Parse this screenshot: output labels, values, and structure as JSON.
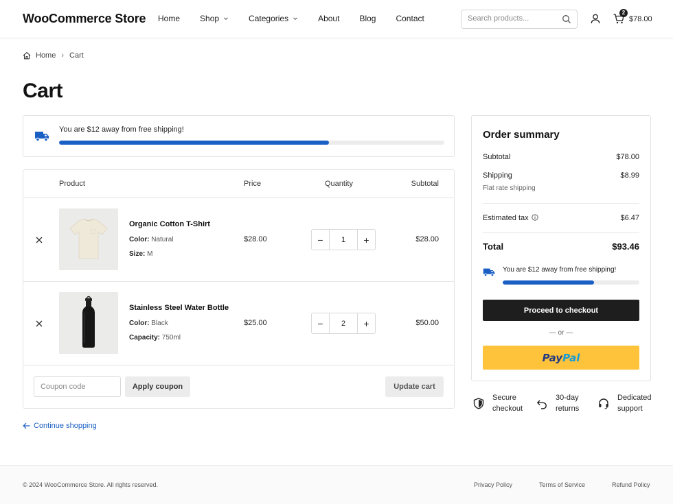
{
  "header": {
    "logo": "WooCommerce Store",
    "nav": [
      "Home",
      "Shop",
      "Categories",
      "About",
      "Blog",
      "Contact"
    ],
    "search_placeholder": "Search products...",
    "cart_count": "2",
    "cart_total": "$78.00"
  },
  "breadcrumb": {
    "home": "Home",
    "current": "Cart"
  },
  "page_title": "Cart",
  "shipping_notice": {
    "message": "You are $12 away from free shipping!",
    "progress": 0.7
  },
  "table": {
    "headers": {
      "product": "Product",
      "price": "Price",
      "quantity": "Quantity",
      "subtotal": "Subtotal"
    },
    "items": [
      {
        "name": "Organic Cotton T-Shirt",
        "attr1_label": "Color:",
        "attr1_value": "Natural",
        "attr2_label": "Size:",
        "attr2_value": "M",
        "price": "$28.00",
        "quantity": "1",
        "subtotal": "$28.00"
      },
      {
        "name": "Stainless Steel Water Bottle",
        "attr1_label": "Color:",
        "attr1_value": "Black",
        "attr2_label": "Capacity:",
        "attr2_value": "750ml",
        "price": "$25.00",
        "quantity": "2",
        "subtotal": "$50.00"
      }
    ],
    "coupon_placeholder": "Coupon code",
    "apply_label": "Apply coupon",
    "update_label": "Update cart"
  },
  "continue_label": "Continue shopping",
  "summary": {
    "title": "Order summary",
    "subtotal_label": "Subtotal",
    "subtotal_value": "$78.00",
    "shipping_label": "Shipping",
    "shipping_value": "$8.99",
    "shipping_method": "Flat rate shipping",
    "tax_label": "Estimated tax",
    "tax_value": "$6.47",
    "total_label": "Total",
    "total_value": "$93.46",
    "shipping_message": "You are $12 away from free shipping!",
    "shipping_progress": 0.67,
    "checkout_label": "Proceed to checkout",
    "or_label": "— or —",
    "paypal_pay": "Pay",
    "paypal_pal": "Pal"
  },
  "trust": [
    {
      "line1": "Secure",
      "line2": "checkout",
      "icon": "shield-icon"
    },
    {
      "line1": "30-day",
      "line2": "returns",
      "icon": "return-arrow-icon"
    },
    {
      "line1": "Dedicated",
      "line2": "support",
      "icon": "headset-icon"
    }
  ],
  "footer": {
    "copyright": "© 2024 WooCommerce Store. All rights reserved.",
    "links": [
      "Privacy Policy",
      "Terms of Service",
      "Refund Policy"
    ]
  },
  "colors": {
    "accent": "#1a5fc4",
    "checkout_button": "#1e1e1e",
    "paypal_button": "#fec33a",
    "paypal_dark": "#253b80",
    "paypal_light": "#179bd7"
  }
}
